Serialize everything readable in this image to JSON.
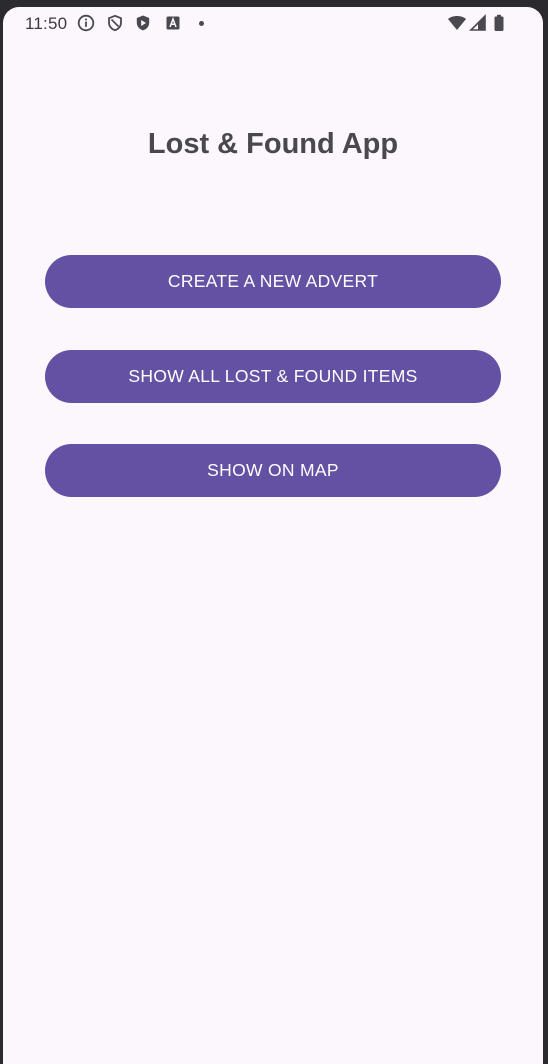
{
  "status_bar": {
    "time": "11:50",
    "left_icons": [
      "info-circle-icon",
      "shield-outline-icon",
      "play-shield-icon",
      "text-a-icon",
      "notification-dot-icon"
    ],
    "right_icons": [
      "wifi-icon",
      "cell-signal-icon",
      "battery-icon"
    ]
  },
  "app": {
    "title": "Lost & Found App",
    "buttons": [
      {
        "label": "CREATE A NEW ADVERT"
      },
      {
        "label": "SHOW ALL LOST & FOUND ITEMS"
      },
      {
        "label": "SHOW ON MAP"
      }
    ]
  },
  "colors": {
    "background": "#fcf7fc",
    "primary": "#6551a3",
    "title_text": "#4a474f",
    "button_text": "#ffffff"
  }
}
